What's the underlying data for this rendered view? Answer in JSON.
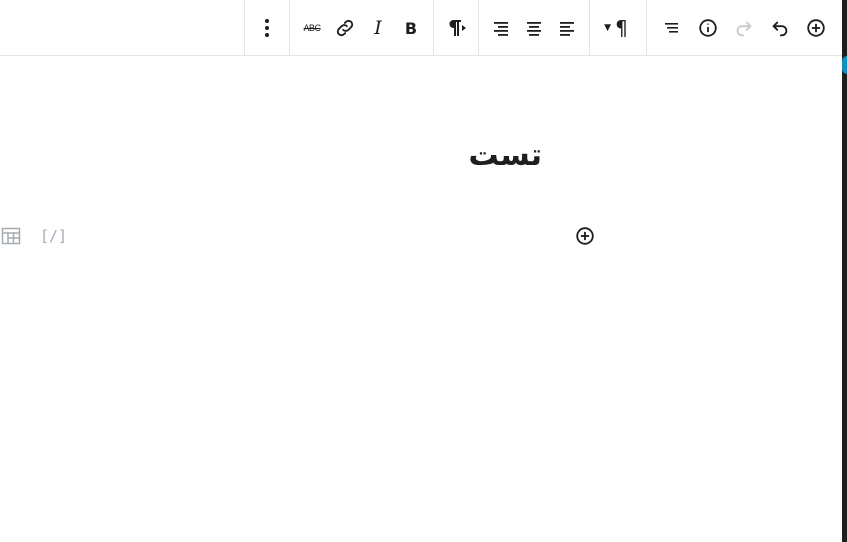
{
  "toolbar": {
    "more_icon": "vertical-ellipsis-icon",
    "strikethrough_label": "ABC",
    "link_icon": "link-icon",
    "italic_label": "I",
    "bold_label": "B",
    "paragraph_direction_icon": "paragraph-ltr-icon",
    "align_right_icon": "align-right-icon",
    "align_center_icon": "align-center-icon",
    "align_left_icon": "align-left-icon",
    "paragraph_dropdown_label": "¶",
    "outline_icon": "list-outline-icon",
    "info_icon": "info-icon",
    "redo_icon": "redo-icon",
    "undo_icon": "undo-icon",
    "add_block_icon": "plus-circle-icon"
  },
  "editor": {
    "title": "تست",
    "shortcode_hint": "[/]"
  },
  "colors": {
    "accent": "#0e8fc4",
    "text": "#1e1e1e",
    "muted": "#a2aab2",
    "border": "#e2e4e7"
  }
}
